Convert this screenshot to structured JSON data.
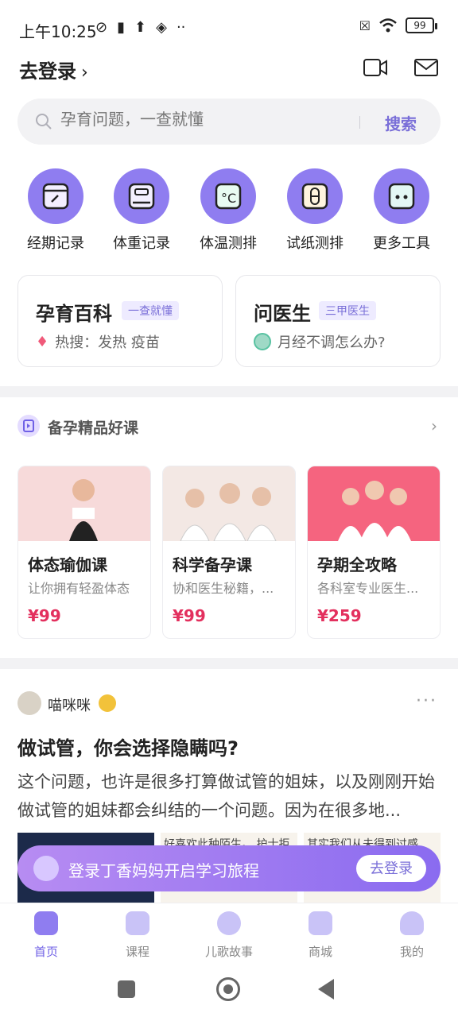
{
  "status": {
    "time": "上午10:25",
    "battery": "99"
  },
  "header": {
    "login_label": "去登录",
    "login_chevron": "›"
  },
  "search": {
    "placeholder": "孕育问题，一查就懂",
    "button": "搜索"
  },
  "tools": [
    {
      "label": "经期记录",
      "icon": "calendar-icon"
    },
    {
      "label": "体重记录",
      "icon": "scale-icon"
    },
    {
      "label": "体温测排",
      "icon": "thermometer-icon"
    },
    {
      "label": "试纸测排",
      "icon": "test-strip-icon"
    },
    {
      "label": "更多工具",
      "icon": "more-tools-icon"
    }
  ],
  "cards": {
    "encyclopedia": {
      "title": "孕育百科",
      "tag": "一查就懂",
      "sub": "热搜：发热 疫苗"
    },
    "doctor": {
      "title": "问医生",
      "tag": "三甲医生",
      "sub": "月经不调怎么办?"
    }
  },
  "courses_section": {
    "title": "备孕精品好课",
    "chevron": "›",
    "items": [
      {
        "title": "体态瑜伽课",
        "desc": "让你拥有轻盈体态",
        "price": "¥99"
      },
      {
        "title": "科学备孕课",
        "desc": "协和医生秘籍，...",
        "price": "¥99"
      },
      {
        "title": "孕期全攻略",
        "desc": "各科室专业医生...",
        "price": "¥259"
      }
    ]
  },
  "post": {
    "username": "喵咪咪",
    "more": "···",
    "title": "做试管，你会选择隐瞒吗?",
    "body": "这个问题，也许是很多打算做试管的姐妹，以及刚刚开始做试管的姐妹都会纠结的一个问题。因为在很多地...",
    "thumb2_text": "好喜欢此种陌生。\n护士拒绝，又再花一天的时",
    "thumb3_text": "其实我们从未得到过感疑，从未接\n荒芜悲凉，好像真的存在，而这些其实"
  },
  "login_banner": {
    "text": "登录丁香妈妈开启学习旅程",
    "button": "去登录"
  },
  "tabbar": [
    {
      "label": "首页",
      "active": true
    },
    {
      "label": "课程",
      "active": false
    },
    {
      "label": "儿歌故事",
      "active": false
    },
    {
      "label": "商城",
      "active": false
    },
    {
      "label": "我的",
      "active": false
    }
  ],
  "colors": {
    "accent": "#8f7df0",
    "price": "#e3305e"
  }
}
